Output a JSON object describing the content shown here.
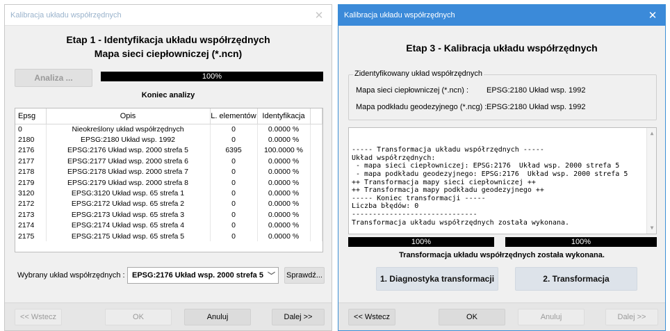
{
  "left": {
    "title": "Kalibracja układu współrzędnych",
    "heading1": "Etap 1 - Identyfikacja układu współrzędnych",
    "heading2": "Mapa sieci ciepłowniczej (*.ncn)",
    "analyze_button": "Analiza ...",
    "progress": "100%",
    "progress_fraction": 1.0,
    "status": "Koniec analizy",
    "columns": [
      "Epsg",
      "Opis",
      "L. elementów",
      "Identyfikacja"
    ],
    "rows": [
      [
        "0",
        "Nieokreślony układ współrzędnych",
        "0",
        "0.0000 %"
      ],
      [
        "2180",
        "EPSG:2180  Układ wsp. 1992",
        "0",
        "0.0000 %"
      ],
      [
        "2176",
        "EPSG:2176  Układ wsp. 2000 strefa 5",
        "6395",
        "100.0000 %"
      ],
      [
        "2177",
        "EPSG:2177  Układ wsp. 2000 strefa 6",
        "0",
        "0.0000 %"
      ],
      [
        "2178",
        "EPSG:2178  Układ wsp. 2000 strefa 7",
        "0",
        "0.0000 %"
      ],
      [
        "2179",
        "EPSG:2179  Układ wsp. 2000 strefa 8",
        "0",
        "0.0000 %"
      ],
      [
        "3120",
        "EPSG:3120  Układ wsp. 65 strefa 1",
        "0",
        "0.0000 %"
      ],
      [
        "2172",
        "EPSG:2172  Układ wsp. 65 strefa 2",
        "0",
        "0.0000 %"
      ],
      [
        "2173",
        "EPSG:2173  Układ wsp. 65 strefa 3",
        "0",
        "0.0000 %"
      ],
      [
        "2174",
        "EPSG:2174  Układ wsp. 65 strefa 4",
        "0",
        "0.0000 %"
      ],
      [
        "2175",
        "EPSG:2175  Układ wsp. 65 strefa 5",
        "0",
        "0.0000 %"
      ]
    ],
    "selected_label": "Wybrany układ współrzędnych :",
    "selected_value": "EPSG:2176  Układ wsp. 2000 strefa 5",
    "check_button": "Sprawdź...",
    "back_button": "<< Wstecz",
    "ok_button": "OK",
    "cancel_button": "Anuluj",
    "next_button": "Dalej >>"
  },
  "right": {
    "title": "Kalibracja układu współrzędnych",
    "heading": "Etap 3 - Kalibracja układu współrzędnych",
    "group_label": "Zidentyfikowany układ współrzędnych",
    "map1_label": "Mapa sieci ciepłowniczej (*.ncn) :",
    "map1_value": "EPSG:2180  Układ wsp. 1992",
    "map2_label": "Mapa podkładu geodezyjnego (*.ncg) :",
    "map2_value": "EPSG:2180  Układ wsp. 1992",
    "log_lines": [
      "----- Transformacja układu współrzędnych -----",
      "Układ współrzędnych:",
      " - mapa sieci ciepłowniczej: EPSG:2176  Układ wsp. 2000 strefa 5",
      " - mapa podkładu geodezyjnego: EPSG:2176  Układ wsp. 2000 strefa 5",
      "++ Transformacja mapy sieci ciepłowniczej ++",
      "++ Transformacja mapy podkładu geodezyjnego ++",
      "----- Koniec transformacji -----",
      "Liczba błędów: 0",
      "------------------------------",
      "Transformacja układu współrzędnych została wykonana."
    ],
    "progress1": "100%",
    "progress1_fraction": 1.0,
    "progress2": "100%",
    "progress2_fraction": 1.0,
    "status": "Transformacja układu współrzędnych została wykonana.",
    "diag_button": "1. Diagnostyka transformacji",
    "transform_button": "2. Transformacja",
    "back_button": "<< Wstecz",
    "ok_button": "OK",
    "cancel_button": "Anuluj",
    "next_button": "Dalej >>"
  }
}
